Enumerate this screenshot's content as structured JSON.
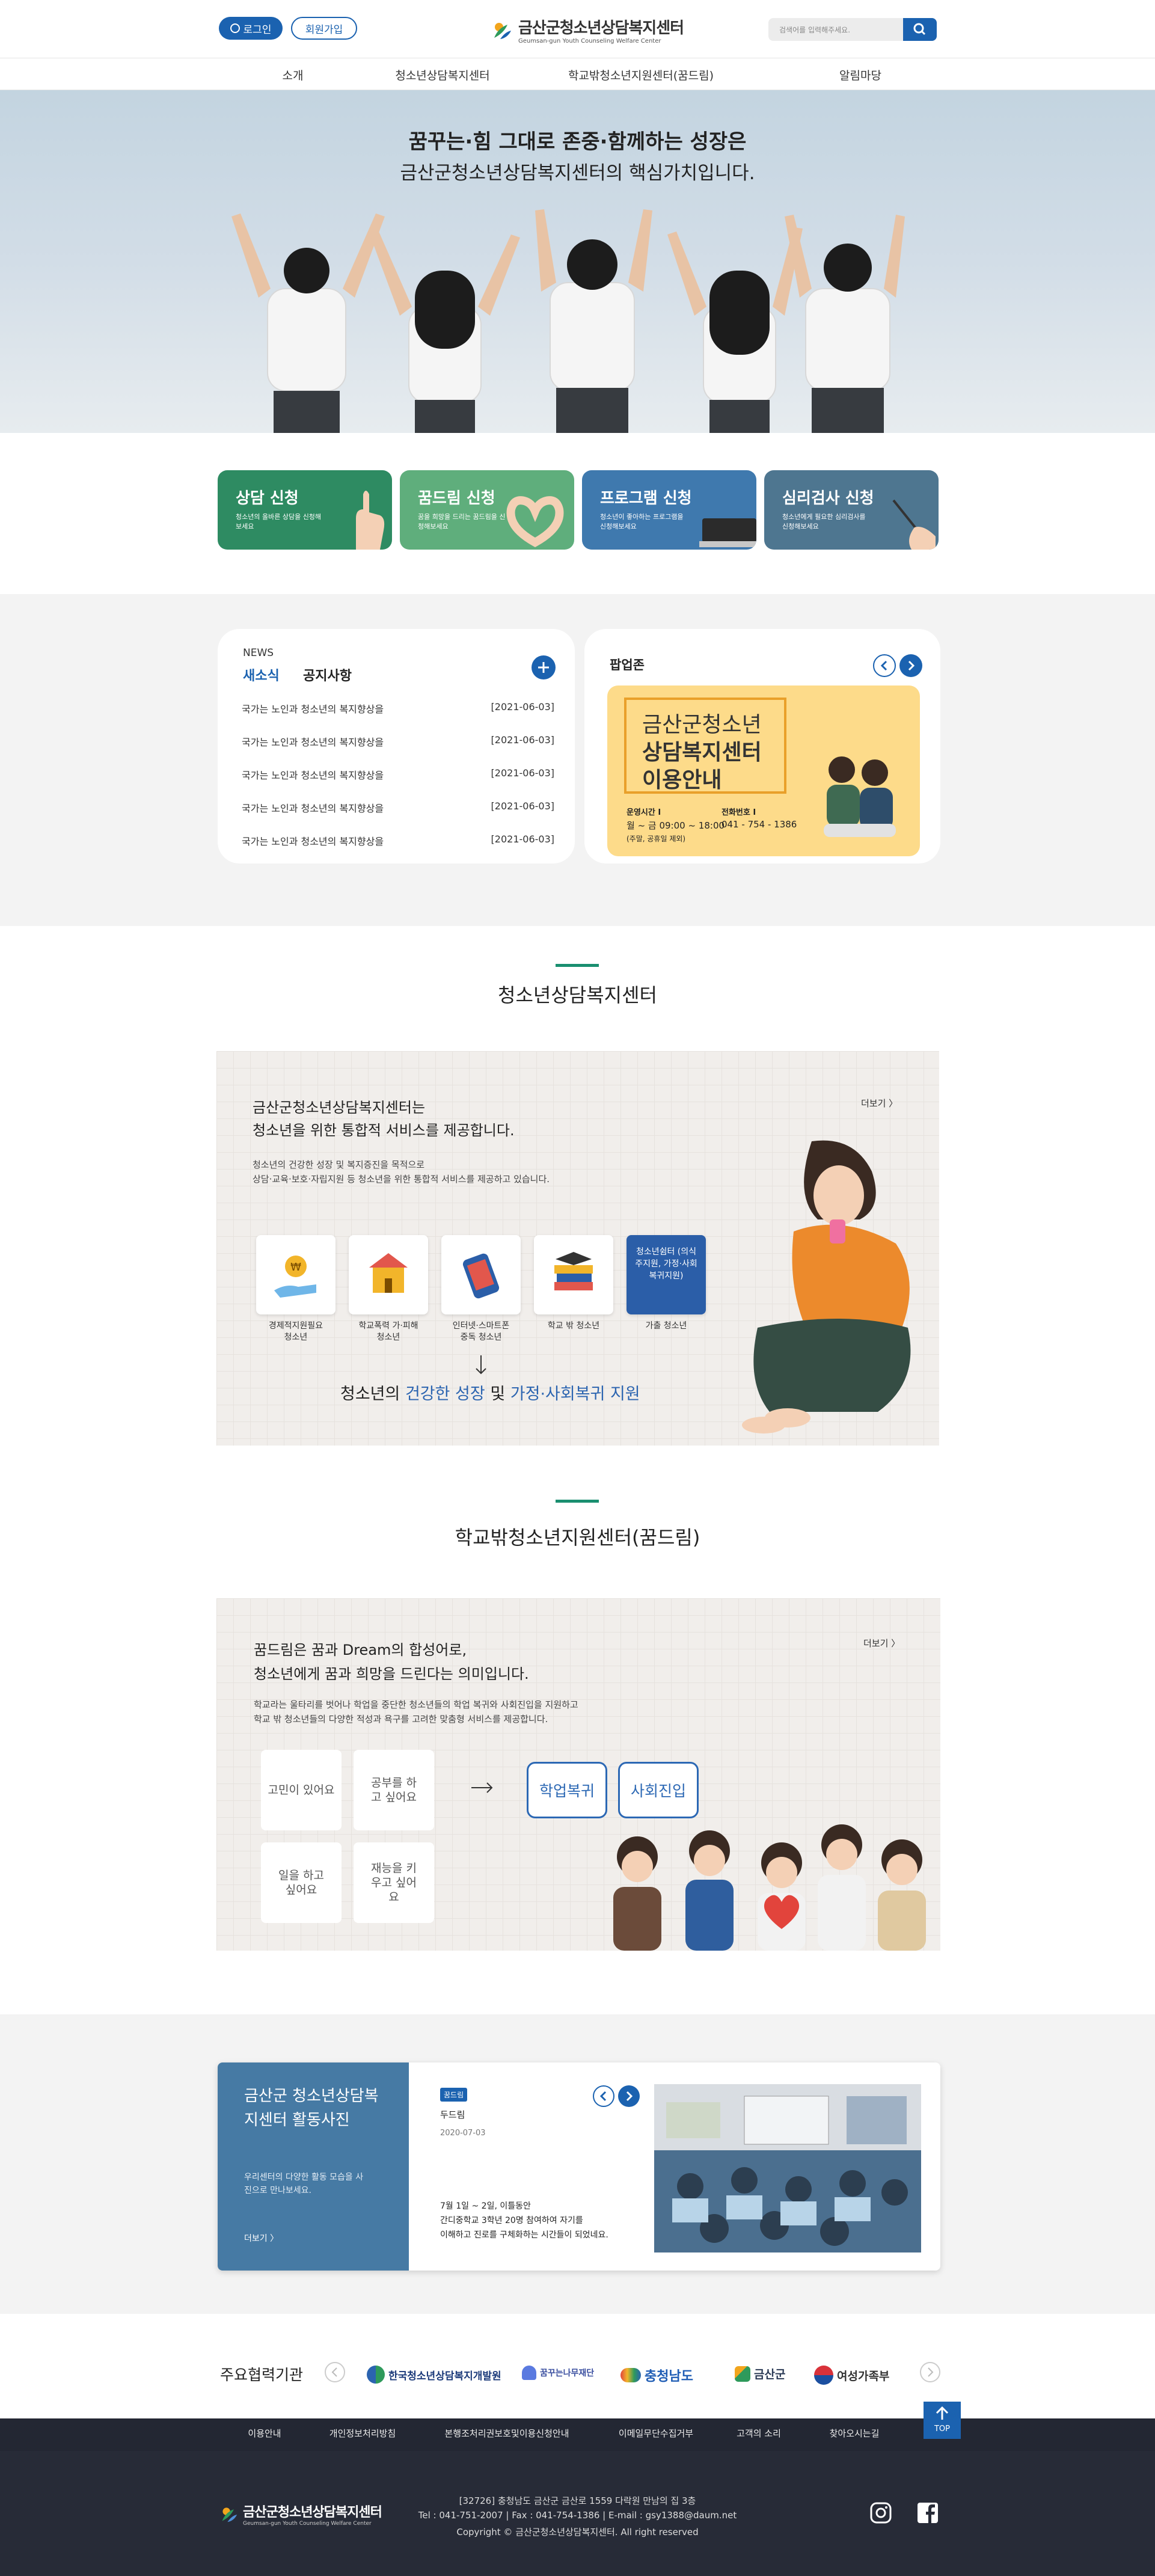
{
  "header": {
    "login": "로그인",
    "join": "회원가입",
    "logo_title": "금산군청소년상담복지센터",
    "logo_sub": "Geumsan-gun Youth Counseling Welfare Center",
    "search_placeholder": "검색어를 입력해주세요."
  },
  "gnb": [
    "소개",
    "청소년상담복지센터",
    "학교밖청소년지원센터(꿈드림)",
    "알림마당"
  ],
  "hero": {
    "line1": "꿈꾸는·힘 그대로 존중·함께하는 성장은",
    "line2": "금산군청소년상담복지센터의 핵심가치입니다."
  },
  "cards": [
    {
      "title": "상담 신청",
      "desc": "청소년의 올바른 상담을 신청해보세요",
      "color": "#2e8b62"
    },
    {
      "title": "꿈드림 신청",
      "desc": "꿈을 희망을 드리는 꿈드림을 신청해보세요",
      "color": "#5fae7c"
    },
    {
      "title": "프로그램 신청",
      "desc": "청소년이 좋아하는 프로그램을 신청해보세요",
      "color": "#3f79ae"
    },
    {
      "title": "심리검사 신청",
      "desc": "청소년에게 필요한 심리검사를 신청해보세요",
      "color": "#4e7690"
    }
  ],
  "news": {
    "eyebrow": "NEWS",
    "tab_active": "새소식",
    "tab_other": "공지사항",
    "add_icon": "plus-icon",
    "items": [
      {
        "title": "국가는 노인과 청소년의 복지향상을",
        "date": "[2021-06-03]"
      },
      {
        "title": "국가는 노인과 청소년의 복지향상을",
        "date": "[2021-06-03]"
      },
      {
        "title": "국가는 노인과 청소년의 복지향상을",
        "date": "[2021-06-03]"
      },
      {
        "title": "국가는 노인과 청소년의 복지향상을",
        "date": "[2021-06-03]"
      },
      {
        "title": "국가는 노인과 청소년의 복지향상을",
        "date": "[2021-06-03]"
      }
    ]
  },
  "popup": {
    "title": "팝업존",
    "banner_line1": "금산군청소년",
    "banner_line2": "상담복지센터",
    "banner_line3": "이용안내",
    "hours_label": "운영시간 I",
    "hours": "월 ~ 금 09:00 ~ 18:00",
    "hours_note": "(주말, 공휴일 제외)",
    "phone_label": "전화번호 I",
    "phone": "041 - 754 - 1386"
  },
  "section1": {
    "title": "청소년상담복지센터",
    "heading1": "금산군청소년상담복지센터는",
    "heading2": "청소년을 위한 통합적 서비스를 제공합니다.",
    "desc1": "청소년의 건강한 성장 및 복지증진을 목적으로",
    "desc2": "상담·교육·보호·자립지원 등 청소년을 위한 통합적 서비스를 제공하고 있습니다.",
    "more": "더보기 〉",
    "icons": [
      {
        "line1": "경제적지원필요",
        "line2": "청소년"
      },
      {
        "line1": "학교폭력 가·피해",
        "line2": "청소년"
      },
      {
        "line1": "인터넷·스마트폰",
        "line2": "중독 청소년"
      },
      {
        "line1": "학교 밖 청소년",
        "line2": ""
      },
      {
        "line1": "가출 청소년",
        "line2": ""
      }
    ],
    "shelter": "청소년쉼터 (의식주지원, 가정·사회 복귀지원)",
    "slogan_pre": "청소년의 ",
    "slogan_b1": "건강한 성장",
    "slogan_mid": " 및 ",
    "slogan_b2": "가정·사회복귀 지원",
    "accent": "#2b64b0"
  },
  "section2": {
    "title": "학교밖청소년지원센터(꿈드림)",
    "heading1": "꿈드림은 꿈과 Dream의 합성어로,",
    "heading2": "청소년에게 꿈과 희망을 드린다는 의미입니다.",
    "desc1": "학교라는 울타리를 벗어나 학업을 중단한 청소년들의 학업 복귀와 사회진입을 지원하고",
    "desc2": "학교 밖 청소년들의 다양한 적성과 욕구를 고려한 맞춤형 서비스를 제공합니다.",
    "more": "더보기 〉",
    "worries": [
      "고민이 있어요",
      "공부를 하고 싶어요",
      "일을 하고 싶어요",
      "재능을 키우고 싶어요"
    ],
    "outcomes": [
      "학업복귀",
      "사회진입"
    ]
  },
  "activity": {
    "title": "금산군 청소년상담복지센터 활동사진",
    "desc": "우리센터의 다양한 활동 모습을 사진으로 만나보세요.",
    "more": "더보기 〉",
    "tag": "꿈드림",
    "post_title": "두드림",
    "post_date": "2020-07-03",
    "body1": "7월 1일 ~ 2일, 이틀동안",
    "body2": "간디중학교 3학년 20명 참여하여 자기를",
    "body3": "이해하고 진로를 구체화하는 시간들이 되었네요."
  },
  "partners": {
    "title": "주요협력기관",
    "items": [
      "한국청소년상담복지개발원",
      "꿈꾸는나무재단",
      "충청남도",
      "금산군",
      "여성가족부"
    ]
  },
  "footer": {
    "links": [
      "이용안내",
      "개인정보처리방침",
      "본행조처리권보호및이용신청안내",
      "이메일무단수집거부",
      "고객의 소리",
      "찾아오시는길"
    ],
    "top": "TOP",
    "logo_title": "금산군청소년상담복지센터",
    "logo_sub": "Geumsan-gun Youth Counseling Welfare Center",
    "address": "[32726] 충청남도 금산군 금산로 1559 다락원 만남의 집 3층",
    "contact": "Tel : 041-751-2007 | Fax : 041-754-1386 | E-mail : gsy1388@daum.net",
    "copyright": "Copyright © 금산군청소년상담복지센터. All right reserved"
  }
}
